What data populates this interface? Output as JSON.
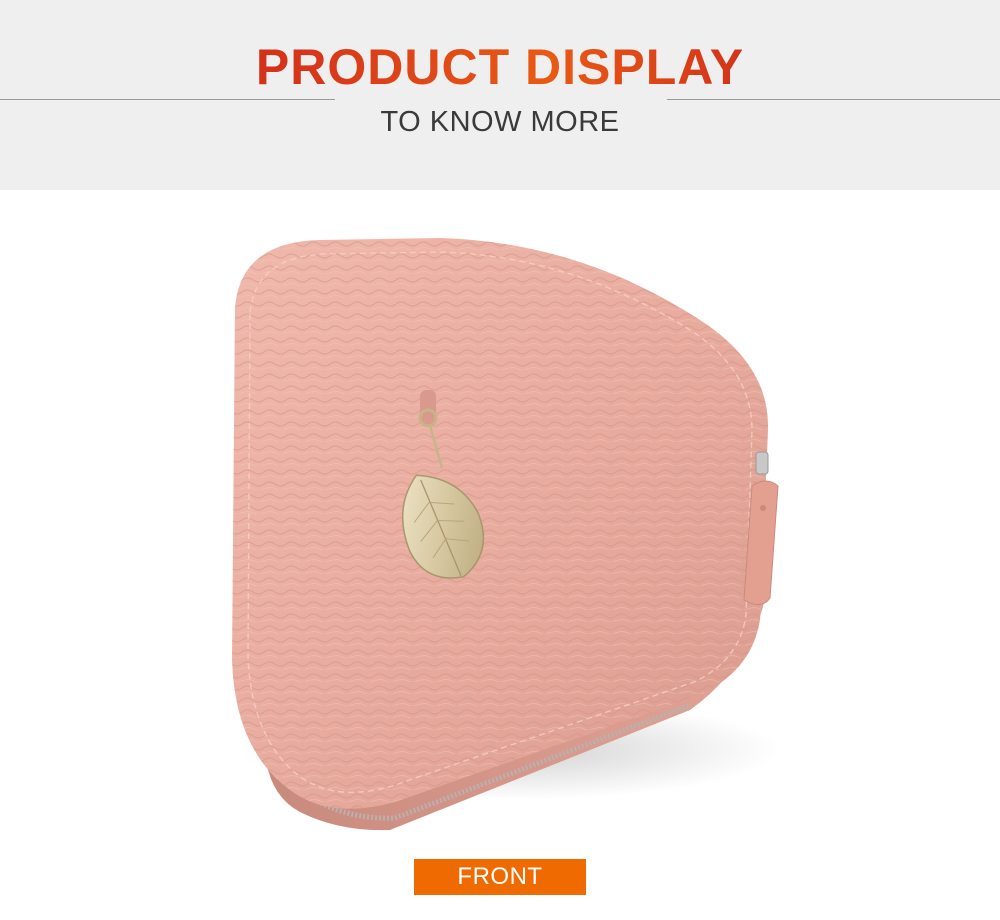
{
  "header": {
    "title": "PRODUCT DISPLAY",
    "subtitle": "TO KNOW MORE"
  },
  "product": {
    "color": "#e7aba0",
    "charm": "gold leaf"
  },
  "caption": {
    "label": "FRONT",
    "color": "#ef6a00"
  }
}
